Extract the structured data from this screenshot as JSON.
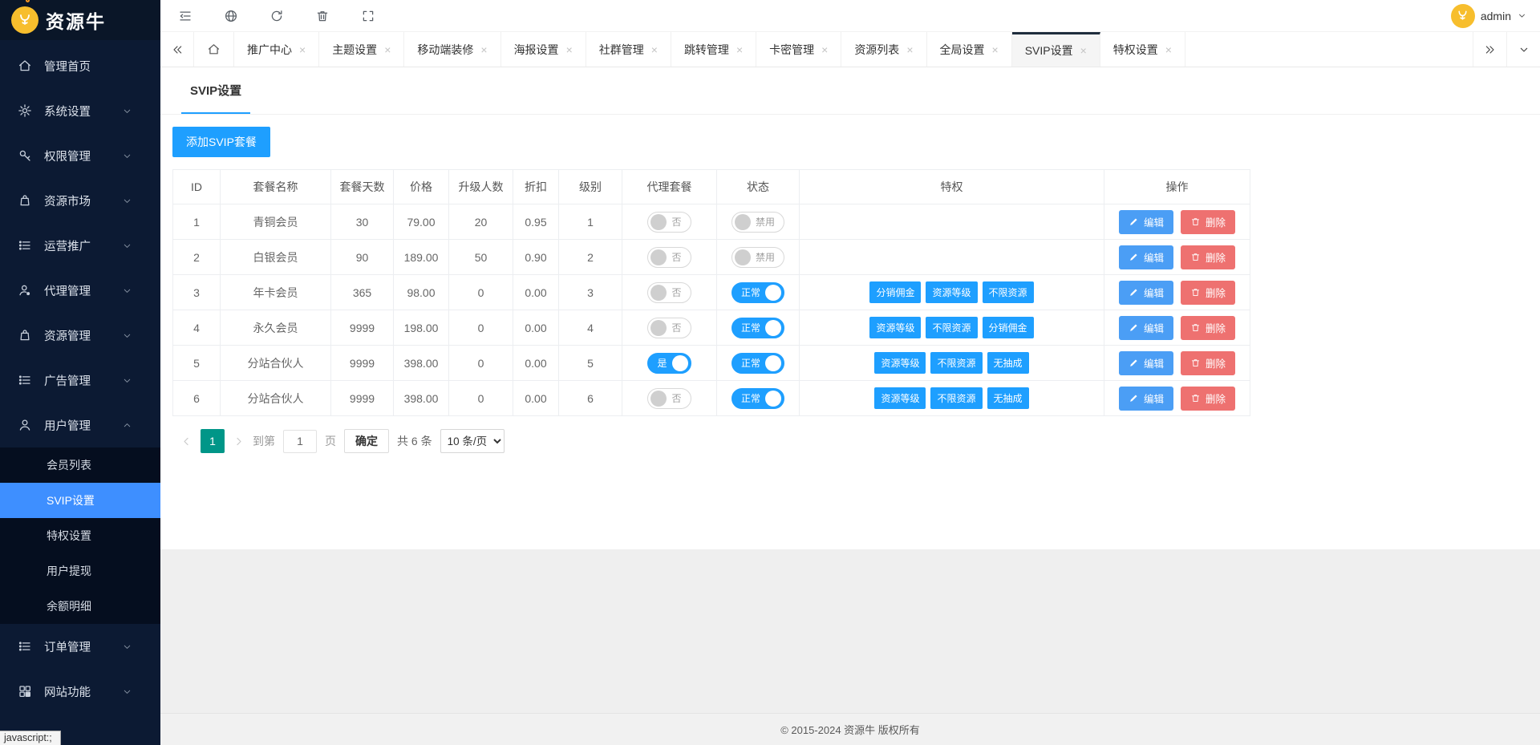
{
  "app": {
    "logo_text": "资源牛",
    "admin_name": "admin"
  },
  "colors": {
    "accent": "#1E9FFF",
    "pagination_active": "#009688",
    "edit_blue": "#4b9ef5",
    "delete_red": "#ee7170",
    "sidebar_active": "#3e8fff",
    "brand_yellow": "#F7BE2D"
  },
  "sidebar": {
    "items": [
      {
        "key": "admin-home",
        "label": "管理首页",
        "icon": "home-icon",
        "expandable": false
      },
      {
        "key": "system-settings",
        "label": "系统设置",
        "icon": "gear-icon",
        "expandable": true
      },
      {
        "key": "permission-mgmt",
        "label": "权限管理",
        "icon": "key-icon",
        "expandable": true
      },
      {
        "key": "resource-market",
        "label": "资源市场",
        "icon": "bag-icon",
        "expandable": true
      },
      {
        "key": "operation-promo",
        "label": "运营推广",
        "icon": "list-icon",
        "expandable": true
      },
      {
        "key": "agent-mgmt",
        "label": "代理管理",
        "icon": "agent-icon",
        "expandable": true
      },
      {
        "key": "resource-mgmt",
        "label": "资源管理",
        "icon": "bag-icon",
        "expandable": true
      },
      {
        "key": "ad-mgmt",
        "label": "广告管理",
        "icon": "list-icon",
        "expandable": true
      },
      {
        "key": "user-mgmt",
        "label": "用户管理",
        "icon": "user-icon",
        "expandable": true,
        "expanded": true,
        "children": [
          {
            "key": "member-list",
            "label": "会员列表",
            "active": false
          },
          {
            "key": "svip-settings",
            "label": "SVIP设置",
            "active": true
          },
          {
            "key": "privilege-settings",
            "label": "特权设置",
            "active": false
          },
          {
            "key": "user-withdraw",
            "label": "用户提现",
            "active": false
          },
          {
            "key": "balance-detail",
            "label": "余额明细",
            "active": false
          }
        ]
      },
      {
        "key": "order-mgmt",
        "label": "订单管理",
        "icon": "list-icon",
        "expandable": true
      },
      {
        "key": "site-features",
        "label": "网站功能",
        "icon": "grid-icon",
        "expandable": true
      }
    ]
  },
  "toolbar": {
    "icons": [
      "menu-fold-icon",
      "globe-icon",
      "refresh-icon",
      "trash-icon",
      "fullscreen-icon"
    ]
  },
  "tabbar": {
    "tabs": [
      {
        "key": "promo-center",
        "label": "推广中心"
      },
      {
        "key": "theme-settings",
        "label": "主题设置"
      },
      {
        "key": "mobile-decor",
        "label": "移动端装修"
      },
      {
        "key": "poster-settings",
        "label": "海报设置"
      },
      {
        "key": "community-mgmt",
        "label": "社群管理"
      },
      {
        "key": "redirect-mgmt",
        "label": "跳转管理"
      },
      {
        "key": "cardkey-mgmt",
        "label": "卡密管理"
      },
      {
        "key": "resource-list",
        "label": "资源列表"
      },
      {
        "key": "global-settings",
        "label": "全局设置"
      },
      {
        "key": "svip-settings",
        "label": "SVIP设置",
        "active": true
      },
      {
        "key": "privilege-settings",
        "label": "特权设置"
      }
    ]
  },
  "page": {
    "title": "SVIP设置",
    "add_button": "添加SVIP套餐"
  },
  "table": {
    "headers": [
      "ID",
      "套餐名称",
      "套餐天数",
      "价格",
      "升级人数",
      "折扣",
      "级别",
      "代理套餐",
      "状态",
      "特权",
      "操作"
    ],
    "action_labels": {
      "edit": "编辑",
      "delete": "删除"
    },
    "rows": [
      {
        "id": "1",
        "name": "青铜会员",
        "days": "30",
        "price": "79.00",
        "upgrade": "20",
        "discount": "0.95",
        "level": "1",
        "agent_label": "否",
        "agent_on": false,
        "status_label": "禁用",
        "status_on": false,
        "privileges": []
      },
      {
        "id": "2",
        "name": "白银会员",
        "days": "90",
        "price": "189.00",
        "upgrade": "50",
        "discount": "0.90",
        "level": "2",
        "agent_label": "否",
        "agent_on": false,
        "status_label": "禁用",
        "status_on": false,
        "privileges": []
      },
      {
        "id": "3",
        "name": "年卡会员",
        "days": "365",
        "price": "98.00",
        "upgrade": "0",
        "discount": "0.00",
        "level": "3",
        "agent_label": "否",
        "agent_on": false,
        "status_label": "正常",
        "status_on": true,
        "privileges": [
          "分销佣金",
          "资源等级",
          "不限资源"
        ]
      },
      {
        "id": "4",
        "name": "永久会员",
        "days": "9999",
        "price": "198.00",
        "upgrade": "0",
        "discount": "0.00",
        "level": "4",
        "agent_label": "否",
        "agent_on": false,
        "status_label": "正常",
        "status_on": true,
        "privileges": [
          "资源等级",
          "不限资源",
          "分销佣金"
        ]
      },
      {
        "id": "5",
        "name": "分站合伙人",
        "days": "9999",
        "price": "398.00",
        "upgrade": "0",
        "discount": "0.00",
        "level": "5",
        "agent_label": "是",
        "agent_on": true,
        "status_label": "正常",
        "status_on": true,
        "privileges": [
          "资源等级",
          "不限资源",
          "无抽成"
        ]
      },
      {
        "id": "6",
        "name": "分站合伙人",
        "days": "9999",
        "price": "398.00",
        "upgrade": "0",
        "discount": "0.00",
        "level": "6",
        "agent_label": "否",
        "agent_on": false,
        "status_label": "正常",
        "status_on": true,
        "privileges": [
          "资源等级",
          "不限资源",
          "无抽成"
        ]
      }
    ]
  },
  "pagination": {
    "current_page": "1",
    "goto_label": "到第",
    "goto_value": "1",
    "goto_unit": "页",
    "confirm_label": "确定",
    "total_label": "共 6 条",
    "page_size_label": "10 条/页"
  },
  "footer": {
    "copyright": "© 2015-2024 资源牛 版权所有"
  },
  "status_bubble": "javascript:;"
}
